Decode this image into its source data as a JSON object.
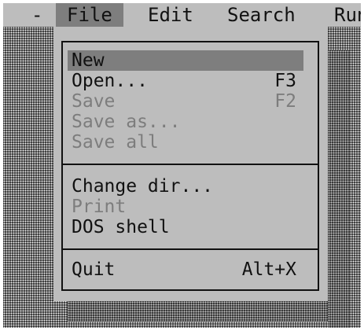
{
  "menubar": {
    "items": [
      {
        "label": "-"
      },
      {
        "label": "File",
        "active": true
      },
      {
        "label": "Edit"
      },
      {
        "label": "Search"
      },
      {
        "label": "Run"
      }
    ]
  },
  "file_menu": {
    "items": [
      {
        "label": "New",
        "shortcut": "",
        "enabled": true,
        "highlighted": true
      },
      {
        "label": "Open...",
        "shortcut": "F3",
        "enabled": true
      },
      {
        "label": "Save",
        "shortcut": "F2",
        "enabled": false
      },
      {
        "label": "Save as...",
        "shortcut": "",
        "enabled": false
      },
      {
        "label": "Save all",
        "shortcut": "",
        "enabled": false
      },
      {
        "label": "Change dir...",
        "shortcut": "",
        "enabled": true
      },
      {
        "label": "Print",
        "shortcut": "",
        "enabled": false
      },
      {
        "label": "DOS shell",
        "shortcut": "",
        "enabled": true
      },
      {
        "label": "Quit",
        "shortcut": "Alt+X",
        "enabled": true
      }
    ]
  },
  "colors": {
    "menu_background": "#bdbdbd",
    "highlight": "#7e7e7e",
    "disabled_text": "#7d7d7d",
    "text": "#111111"
  }
}
